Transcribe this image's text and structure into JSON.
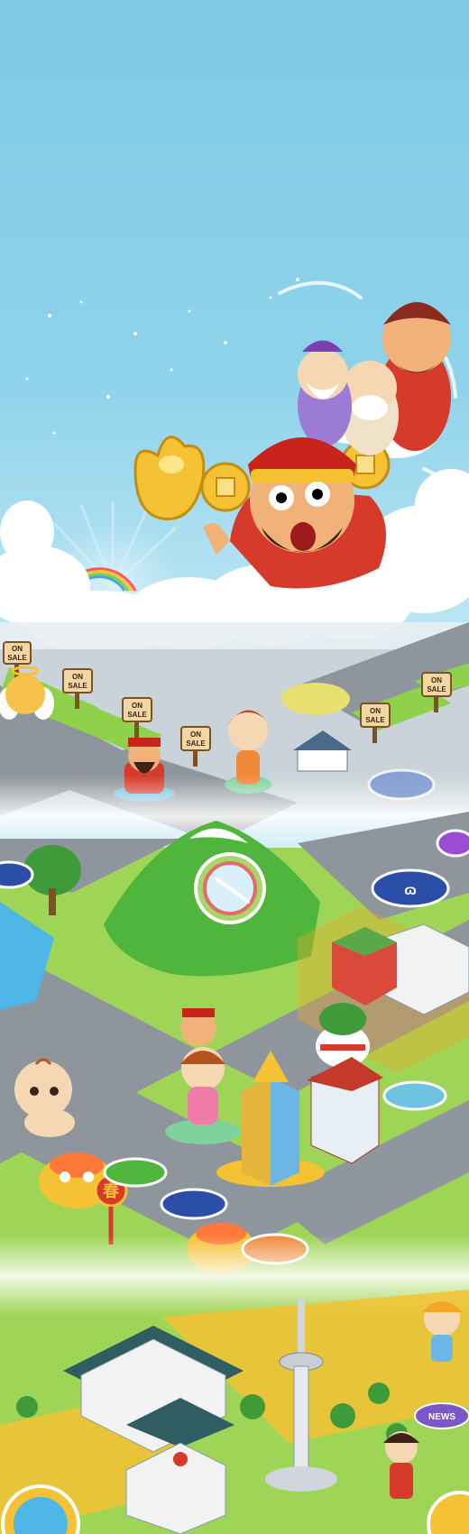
{
  "scene": {
    "sale_signs": [
      {
        "line1": "ON",
        "line2": "SALE"
      },
      {
        "line1": "ON",
        "line2": "SALE"
      },
      {
        "line1": "ON",
        "line2": "SALE"
      },
      {
        "line1": "ON",
        "line2": "SALE"
      },
      {
        "line1": "ON",
        "line2": "SALE"
      },
      {
        "line1": "ON",
        "line2": "SALE"
      }
    ],
    "spring_lantern_text": "春",
    "news_sign_text": "NEWS"
  },
  "colors": {
    "sky_top": "#7ecae4",
    "sky_bottom": "#bfe7f5",
    "cloud": "#ffffff",
    "road": "#8f959c",
    "grass": "#8fd14a",
    "gold": "#f5c233",
    "red": "#d63a2a"
  }
}
